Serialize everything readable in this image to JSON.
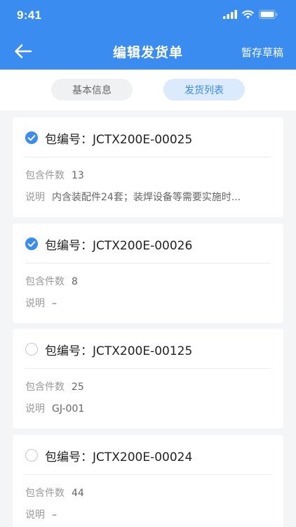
{
  "status_bar": {
    "time": "9:41"
  },
  "navbar": {
    "title": "编辑发货单",
    "action": "暂存草稿"
  },
  "tabs": [
    {
      "label": "基本信息",
      "active": false
    },
    {
      "label": "发货列表",
      "active": true
    }
  ],
  "packages": [
    {
      "title": "包编号：JCTX200E-00025",
      "checked": true,
      "count_label": "包含件数",
      "count": "13",
      "desc_label": "说明",
      "desc": "内含装配件24套；装焊设备等需要实施时..."
    },
    {
      "title": "包编号：JCTX200E-00026",
      "checked": true,
      "count_label": "包含件数",
      "count": "8",
      "desc_label": "说明",
      "desc": "–"
    },
    {
      "title": "包编号：JCTX200E-00125",
      "checked": false,
      "count_label": "包含件数",
      "count": "25",
      "desc_label": "说明",
      "desc": "GJ-001"
    },
    {
      "title": "包编号：JCTX200E-00024",
      "checked": false,
      "count_label": "包含件数",
      "count": "44",
      "desc_label": "说明",
      "desc": "–"
    }
  ],
  "colors": {
    "accent": "#3a8cf0",
    "tab_active_bg": "#dbeafd",
    "page_bg": "#f4f5f7"
  }
}
